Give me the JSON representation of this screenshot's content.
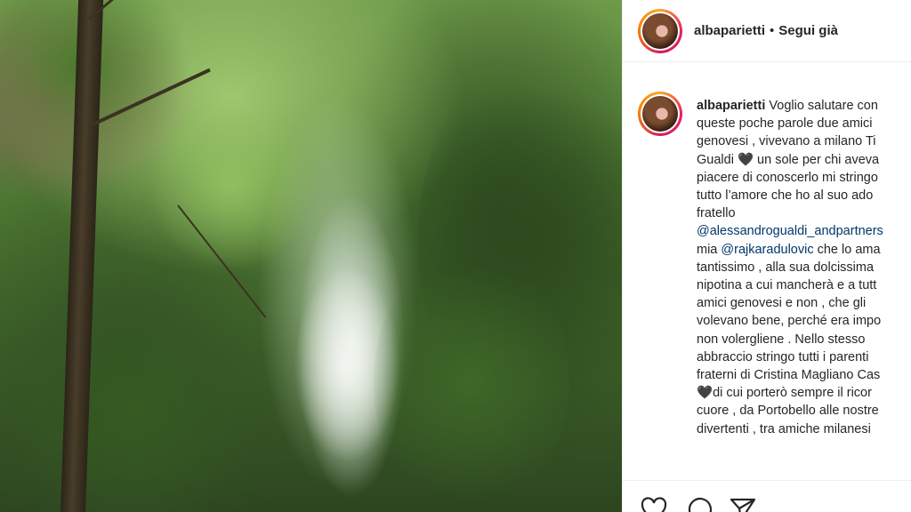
{
  "photo": {
    "alt_description": ""
  },
  "post": {
    "username": "albaparietti",
    "separator": "•",
    "follow_label": "Segui già"
  },
  "caption": {
    "username": "albaparietti",
    "text_1": " Voglio salutare con\nqueste poche parole due amici\ngenovesi , vivevano a milano Ti\nGualdi ",
    "heart_1": "🖤",
    "text_2": " un sole per chi aveva\npiacere di conoscerlo mi stringo\ntutto l’amore che ho al suo ado\nfratello\n",
    "mention_1": "@alessandrogualdi_andpartners",
    "text_3": "\nmia ",
    "mention_2": "@rajkaradulovic",
    "text_4": " che lo ama\ntantissimo , alla sua dolcissima\nnipotina a cui mancherà e a tutt\namici genovesi e non , che gli\nvolevano bene, perché era impo\nnon volergliene . Nello stesso\nabbraccio stringo tutti i parenti\nfraterni di Cristina Magliano Cas\n",
    "heart_2": "🖤",
    "text_5": "di cui porterò sempre il ricor\ncuore , da Portobello alle nostre\ndivertenti , tra amiche milanesi"
  },
  "actions": [
    "heart-icon",
    "comment-icon",
    "share-icon"
  ]
}
